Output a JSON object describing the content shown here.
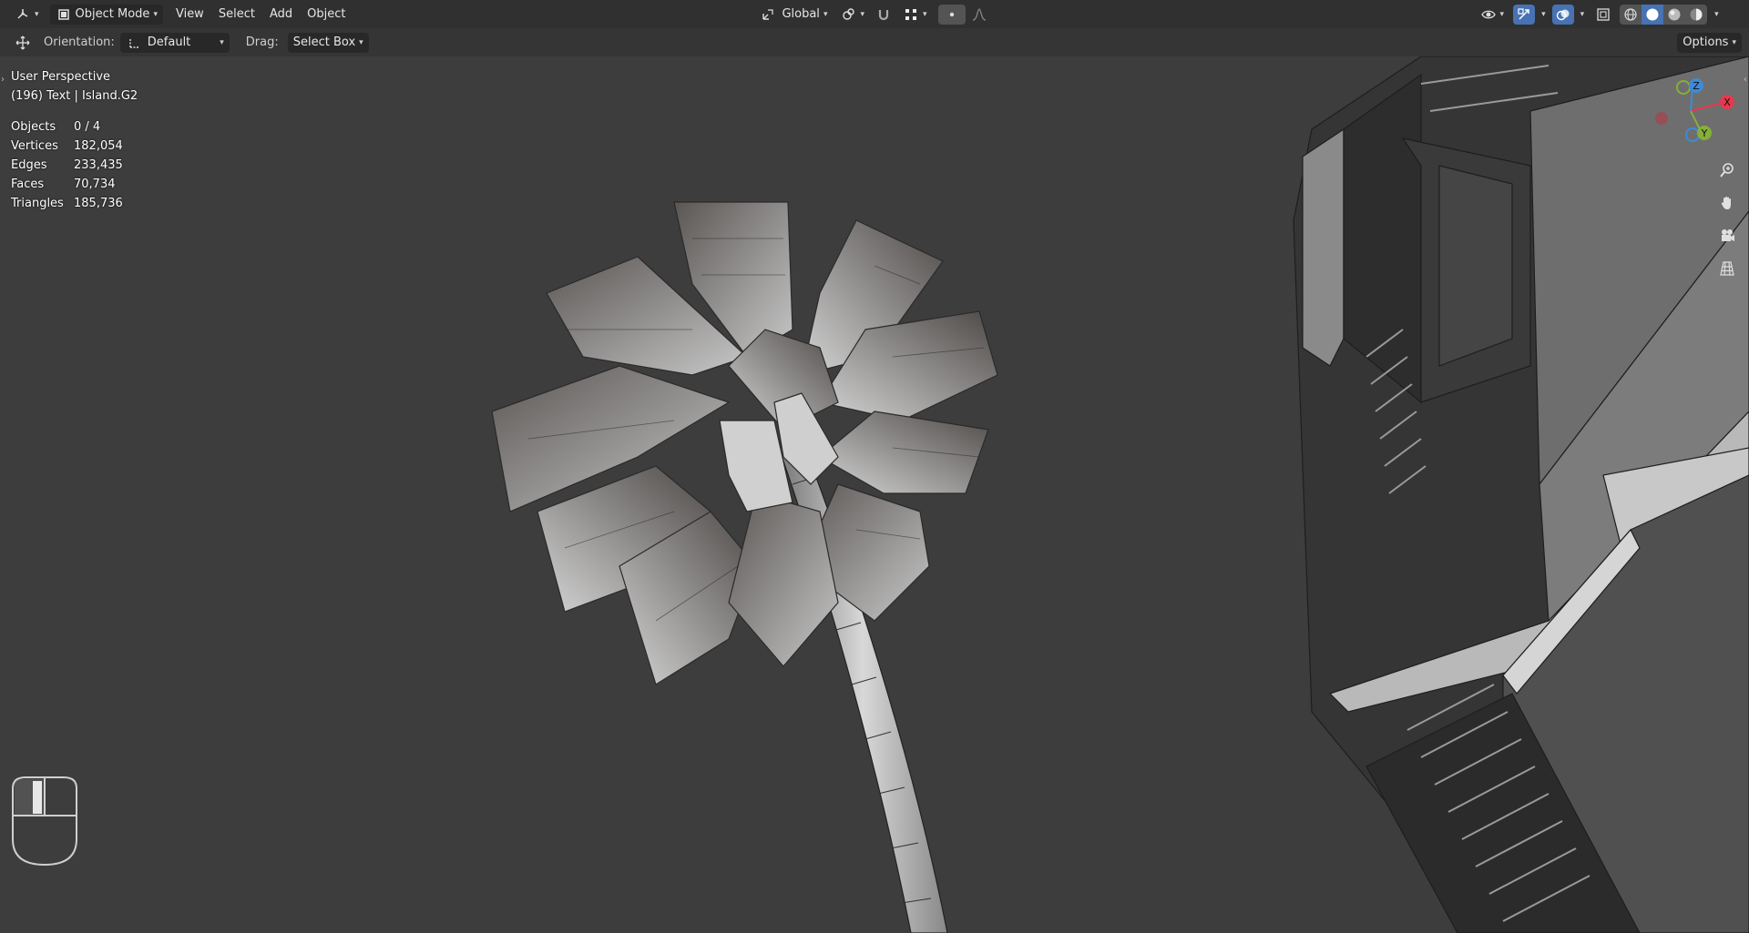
{
  "header": {
    "editor_type_icon": "view3d-icon",
    "mode": "Object Mode",
    "menus": [
      "View",
      "Select",
      "Add",
      "Object"
    ],
    "transform_orientation": "Global"
  },
  "tool_header": {
    "orientation_label": "Orientation:",
    "orientation_value": "Default",
    "drag_label": "Drag:",
    "drag_value": "Select Box",
    "options_label": "Options"
  },
  "viewport": {
    "view_name": "User Perspective",
    "object_info": "(196) Text | Island.G2",
    "stats": [
      {
        "label": "Objects",
        "value": "0 / 4"
      },
      {
        "label": "Vertices",
        "value": "182,054"
      },
      {
        "label": "Edges",
        "value": "233,435"
      },
      {
        "label": "Faces",
        "value": "70,734"
      },
      {
        "label": "Triangles",
        "value": "185,736"
      }
    ],
    "gizmo": {
      "x": "X",
      "y": "Y",
      "z": "Z"
    }
  },
  "colors": {
    "accent": "#4772b3",
    "axis_x": "#e6394e",
    "axis_y": "#84b03a",
    "axis_z": "#3f8ad8",
    "viewport_bg": "#3d3d3d"
  }
}
